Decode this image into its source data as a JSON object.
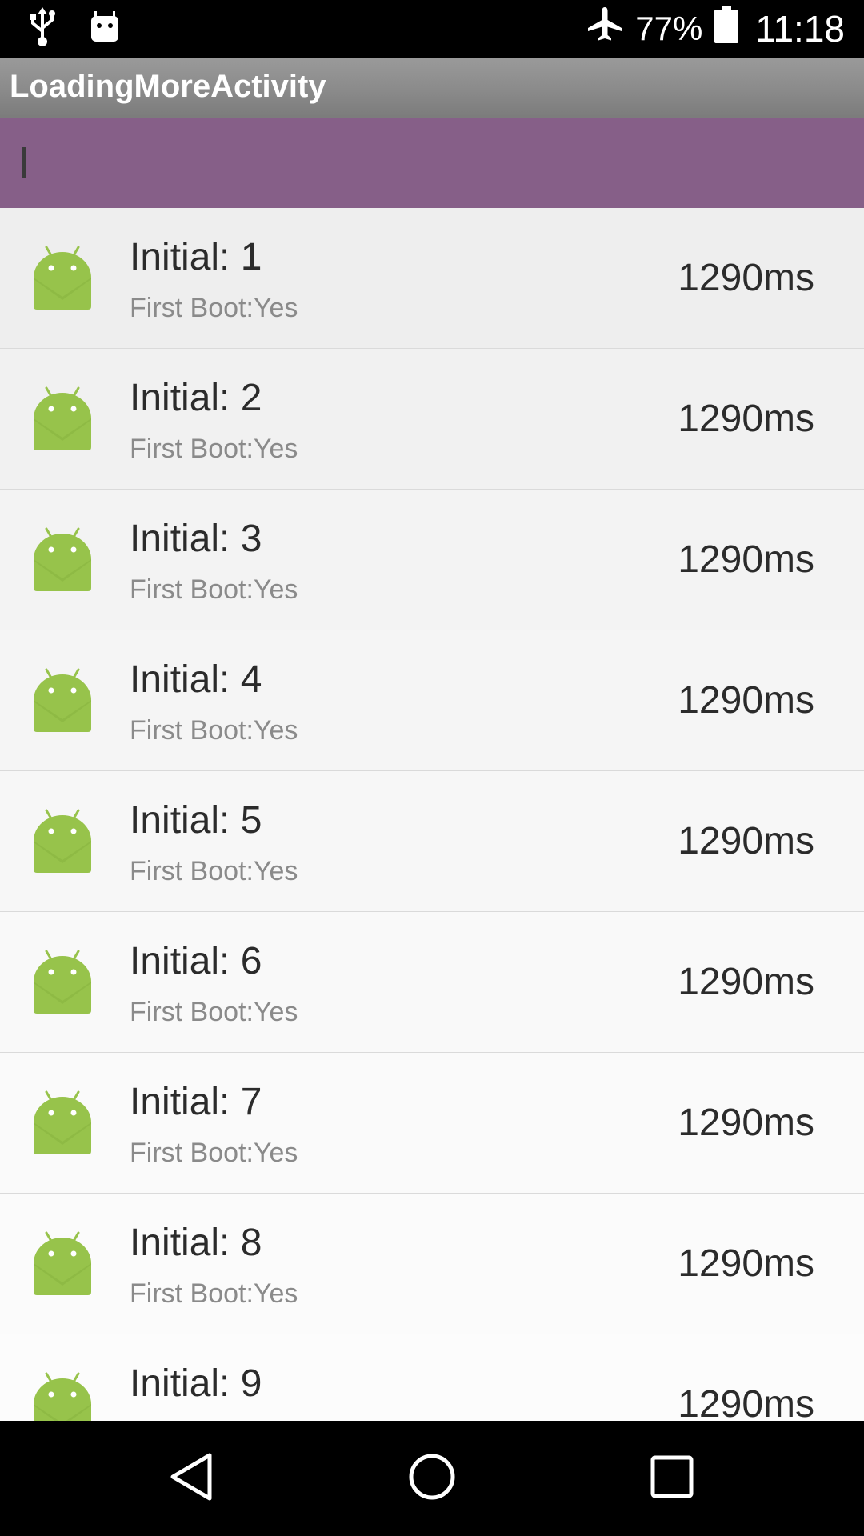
{
  "status_bar": {
    "battery_percent": "77%",
    "time": "11:18",
    "icons": [
      "usb-icon",
      "android-debug-icon",
      "airplane-icon",
      "battery-icon"
    ]
  },
  "action_bar": {
    "title": "LoadingMoreActivity"
  },
  "input_bar": {
    "value": "",
    "color": "#865f88"
  },
  "list": {
    "items": [
      {
        "title": "Initial: 1",
        "subtitle": "First Boot:Yes",
        "time": "1290ms"
      },
      {
        "title": "Initial: 2",
        "subtitle": "First Boot:Yes",
        "time": "1290ms"
      },
      {
        "title": "Initial: 3",
        "subtitle": "First Boot:Yes",
        "time": "1290ms"
      },
      {
        "title": "Initial: 4",
        "subtitle": "First Boot:Yes",
        "time": "1290ms"
      },
      {
        "title": "Initial: 5",
        "subtitle": "First Boot:Yes",
        "time": "1290ms"
      },
      {
        "title": "Initial: 6",
        "subtitle": "First Boot:Yes",
        "time": "1290ms"
      },
      {
        "title": "Initial: 7",
        "subtitle": "First Boot:Yes",
        "time": "1290ms"
      },
      {
        "title": "Initial: 8",
        "subtitle": "First Boot:Yes",
        "time": "1290ms"
      },
      {
        "title": "Initial: 9",
        "subtitle": "",
        "time": "1290ms"
      }
    ]
  },
  "nav_bar": {
    "buttons": [
      "back-icon",
      "home-icon",
      "recents-icon"
    ]
  },
  "colors": {
    "android_green": "#97c34b",
    "accent_purple": "#865f88"
  }
}
